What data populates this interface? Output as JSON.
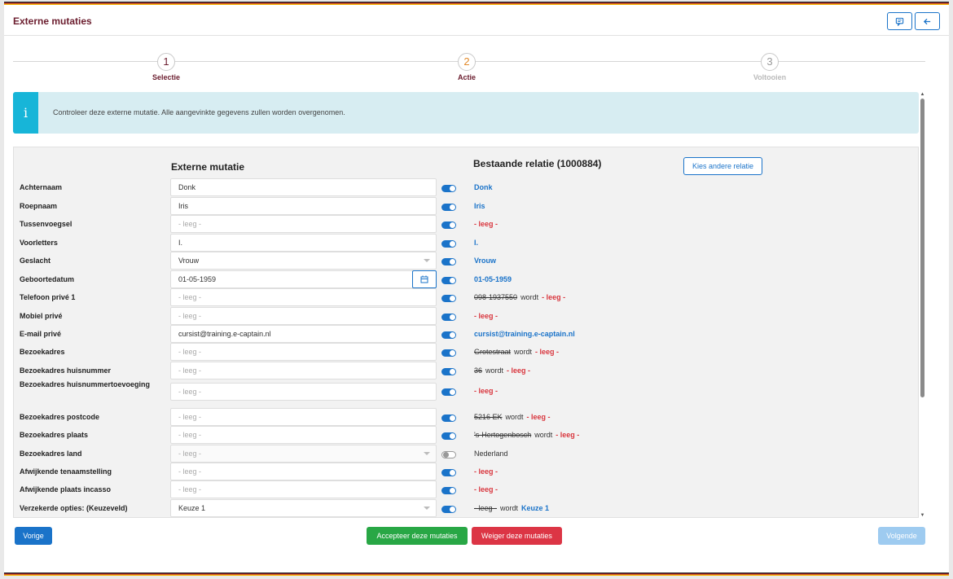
{
  "header": {
    "title": "Externe mutaties",
    "icons": [
      "comment-icon",
      "arrow-left-icon"
    ]
  },
  "steps": [
    {
      "number": "1",
      "label": "Selectie",
      "state": "done"
    },
    {
      "number": "2",
      "label": "Actie",
      "state": "active"
    },
    {
      "number": "3",
      "label": "Voltooien",
      "state": "disabled"
    }
  ],
  "alert": {
    "icon": "i",
    "text": "Controleer deze externe mutatie. Alle aangevinkte gegevens zullen worden overgenomen."
  },
  "panel": {
    "col_left": "Externe mutatie",
    "col_right": "Bestaande relatie (1000884)",
    "kies_button": "Kies andere relatie"
  },
  "rows": [
    {
      "label": "Achternaam",
      "value": "Donk",
      "empty": false,
      "toggle": true,
      "right": {
        "type": "blue",
        "text": "Donk"
      }
    },
    {
      "label": "Roepnaam",
      "value": "Iris",
      "empty": false,
      "toggle": true,
      "right": {
        "type": "blue",
        "text": "Iris"
      }
    },
    {
      "label": "Tussenvoegsel",
      "value": "- leeg -",
      "empty": true,
      "toggle": true,
      "right": {
        "type": "red",
        "text": "- leeg -"
      }
    },
    {
      "label": "Voorletters",
      "value": "I.",
      "empty": false,
      "toggle": true,
      "right": {
        "type": "blue",
        "text": "I."
      }
    },
    {
      "label": "Geslacht",
      "value": "Vrouw",
      "empty": false,
      "select": true,
      "toggle": true,
      "right": {
        "type": "blue",
        "text": "Vrouw"
      }
    },
    {
      "label": "Geboortedatum",
      "value": "01-05-1959",
      "empty": false,
      "date": true,
      "toggle": true,
      "right": {
        "type": "blue",
        "text": "01-05-1959"
      }
    },
    {
      "label": "Telefoon privé 1",
      "value": "- leeg -",
      "empty": true,
      "toggle": true,
      "right": {
        "type": "change",
        "old": "098-1937550",
        "word": "wordt",
        "new": "- leeg -",
        "new_type": "red"
      }
    },
    {
      "label": "Mobiel privé",
      "value": "- leeg -",
      "empty": true,
      "toggle": true,
      "right": {
        "type": "red",
        "text": "- leeg -"
      }
    },
    {
      "label": "E-mail privé",
      "value": "cursist@training.e-captain.nl",
      "empty": false,
      "toggle": true,
      "right": {
        "type": "blue",
        "text": "cursist@training.e-captain.nl"
      }
    },
    {
      "label": "Bezoekadres",
      "value": "- leeg -",
      "empty": true,
      "toggle": true,
      "right": {
        "type": "change",
        "old": "Grotestraat",
        "word": "wordt",
        "new": "- leeg -",
        "new_type": "red"
      }
    },
    {
      "label": "Bezoekadres huisnummer",
      "value": "- leeg -",
      "empty": true,
      "toggle": true,
      "right": {
        "type": "change",
        "old": "36",
        "word": "wordt",
        "new": "- leeg -",
        "new_type": "red"
      }
    },
    {
      "label": "Bezoekadres huisnummertoevoeging",
      "value": "- leeg -",
      "empty": true,
      "toggle": true,
      "tall": true,
      "right": {
        "type": "red",
        "text": "- leeg -"
      }
    },
    {
      "label": "Bezoekadres postcode",
      "value": "- leeg -",
      "empty": true,
      "toggle": true,
      "right": {
        "type": "change",
        "old": "5216 EK",
        "word": "wordt",
        "new": "- leeg -",
        "new_type": "red"
      }
    },
    {
      "label": "Bezoekadres plaats",
      "value": "- leeg -",
      "empty": true,
      "toggle": true,
      "right": {
        "type": "change",
        "old": "'s-Hertogenbosch",
        "word": "wordt",
        "new": "- leeg -",
        "new_type": "red"
      }
    },
    {
      "label": "Bezoekadres land",
      "value": "- leeg -",
      "empty": true,
      "select": true,
      "disabled": true,
      "toggle": false,
      "right": {
        "type": "plain",
        "text": "Nederland"
      }
    },
    {
      "label": "Afwijkende tenaamstelling",
      "value": "- leeg -",
      "empty": true,
      "toggle": true,
      "right": {
        "type": "red",
        "text": "- leeg -"
      }
    },
    {
      "label": "Afwijkende plaats incasso",
      "value": "- leeg -",
      "empty": true,
      "toggle": true,
      "right": {
        "type": "red",
        "text": "- leeg -"
      }
    },
    {
      "label": "Verzekerde opties: (Keuzeveld)",
      "value": "Keuze 1",
      "empty": false,
      "select": true,
      "toggle": true,
      "right": {
        "type": "change",
        "old": "- leeg -",
        "word": "wordt",
        "new": "Keuze 1",
        "new_type": "blue"
      }
    }
  ],
  "buttons": {
    "prev": "Vorige",
    "accept": "Accepteer deze mutaties",
    "reject": "Weiger deze mutaties",
    "next": "Volgende"
  },
  "colors": {
    "primary": "#1a73c9",
    "success": "#28a745",
    "danger": "#dc3545",
    "maroon": "#6b1d2e"
  }
}
